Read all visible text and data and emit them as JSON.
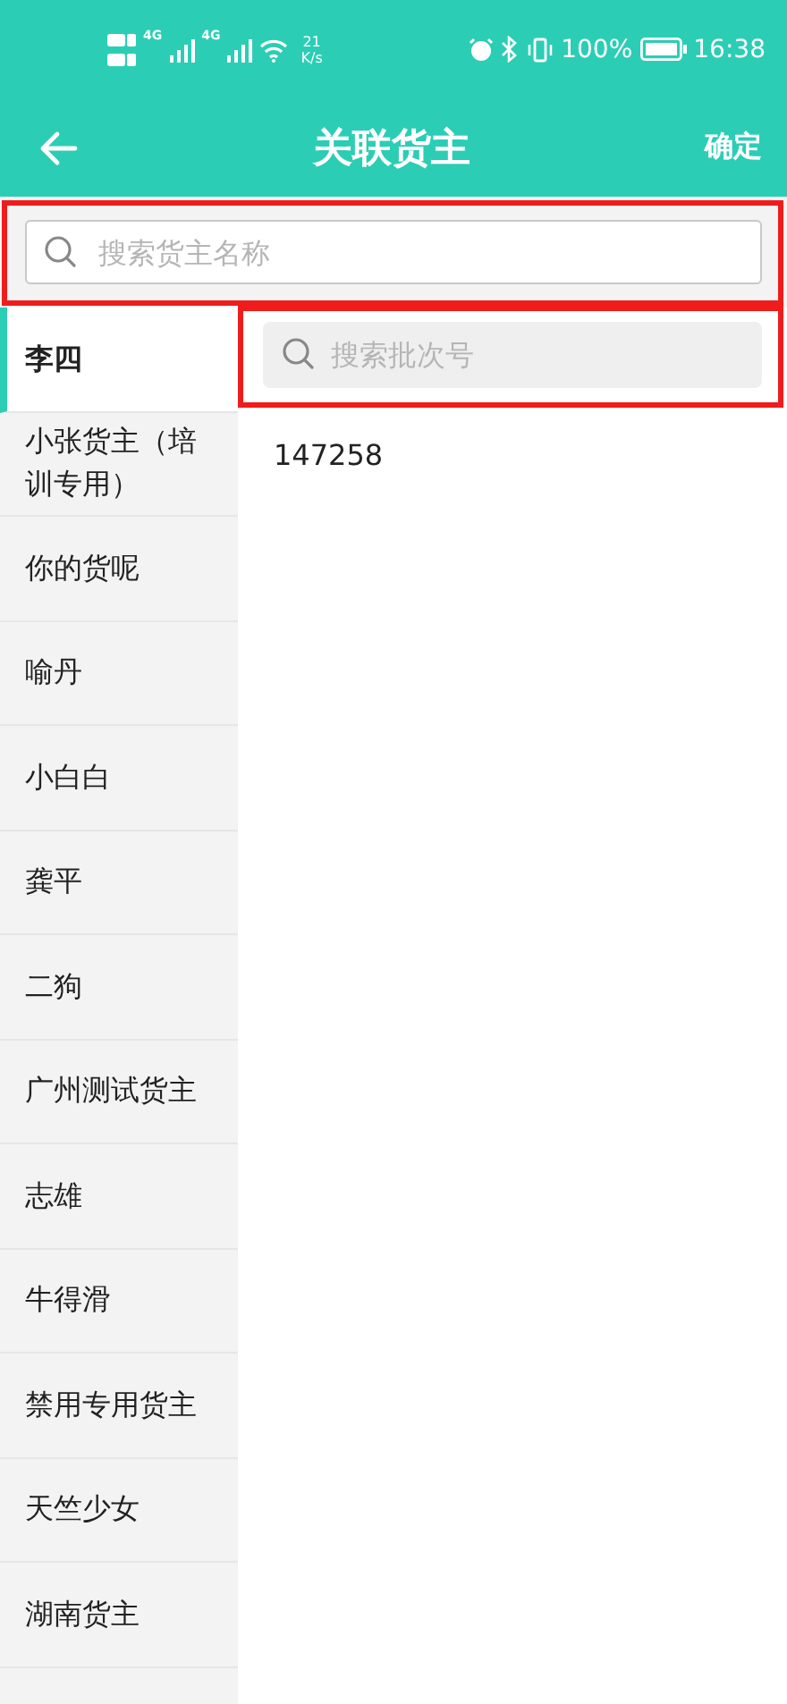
{
  "status_bar": {
    "network_1": "4G",
    "network_2": "4G",
    "speed_value": "21",
    "speed_unit": "K/s",
    "battery": "100%",
    "time": "16:38"
  },
  "header": {
    "title": "关联货主",
    "action": "确定"
  },
  "owner_search": {
    "placeholder": "搜索货主名称"
  },
  "batch_search": {
    "placeholder": "搜索批次号"
  },
  "owners": [
    {
      "name": "李四",
      "selected": true
    },
    {
      "name": "小张货主（培训专用）",
      "selected": false
    },
    {
      "name": "你的货呢",
      "selected": false
    },
    {
      "name": "喻丹",
      "selected": false
    },
    {
      "name": "小白白",
      "selected": false
    },
    {
      "name": "龚平",
      "selected": false
    },
    {
      "name": "二狗",
      "selected": false
    },
    {
      "name": "广州测试货主",
      "selected": false
    },
    {
      "name": "志雄",
      "selected": false
    },
    {
      "name": "牛得滑",
      "selected": false
    },
    {
      "name": "禁用专用货主",
      "selected": false
    },
    {
      "name": "天竺少女",
      "selected": false
    },
    {
      "name": "湖南货主",
      "selected": false
    }
  ],
  "batches": [
    "147258"
  ]
}
